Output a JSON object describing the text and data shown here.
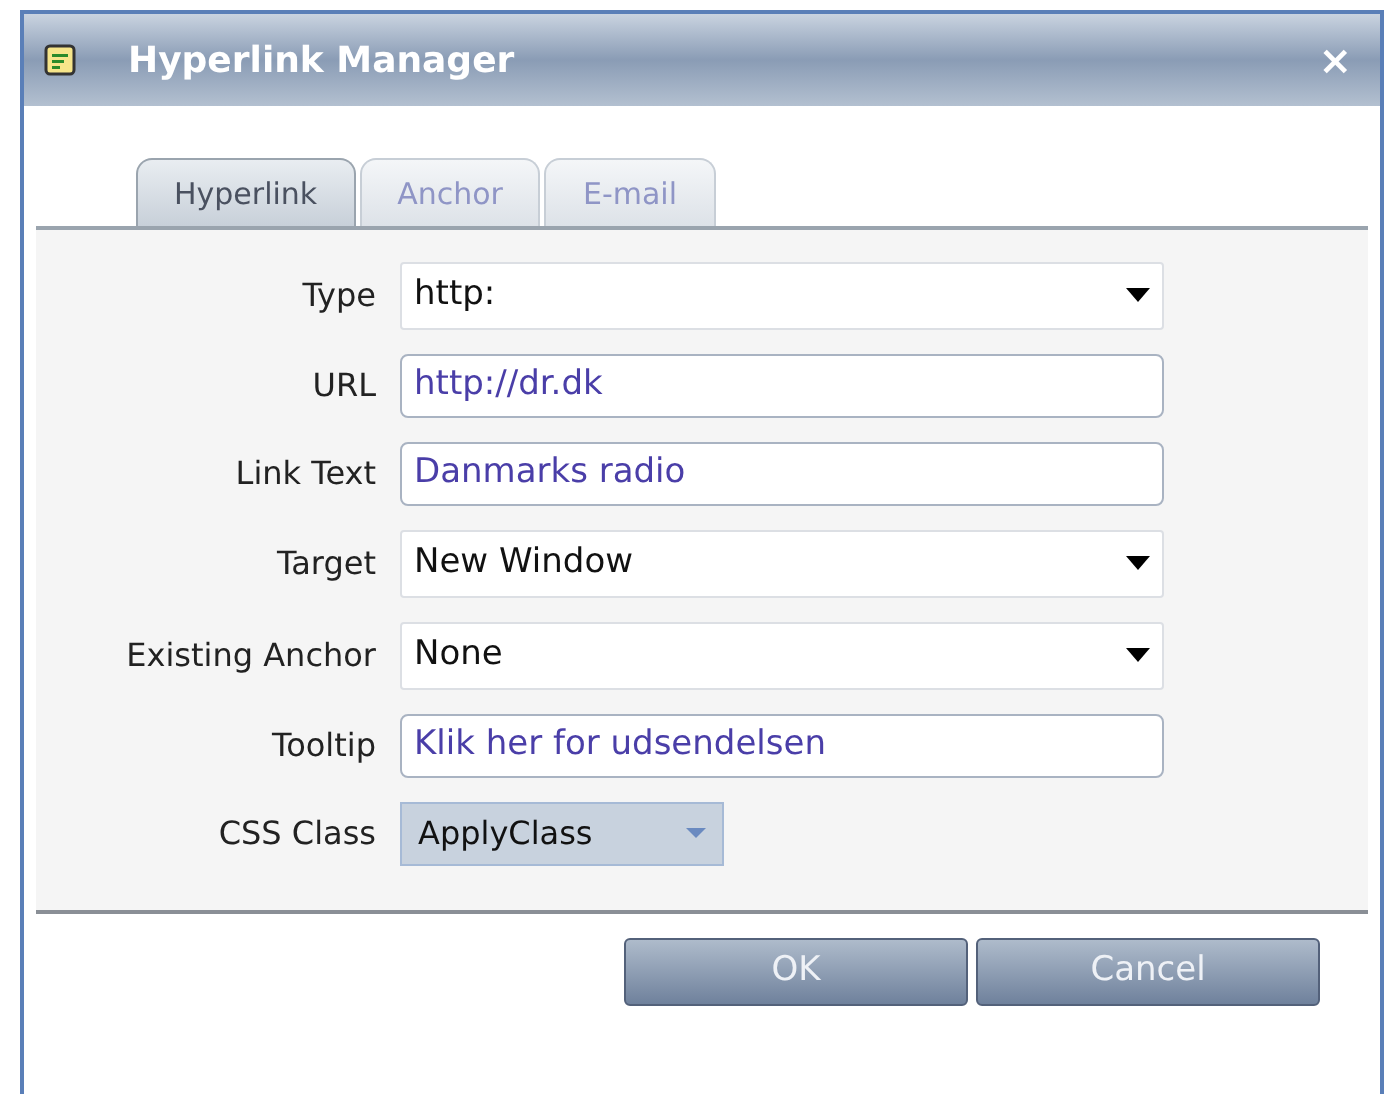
{
  "window": {
    "title": "Hyperlink Manager",
    "close": "×"
  },
  "tabs": [
    {
      "label": "Hyperlink",
      "selected": true
    },
    {
      "label": "Anchor",
      "selected": false
    },
    {
      "label": "E-mail",
      "selected": false
    }
  ],
  "fields": [
    {
      "label": "Type",
      "kind": "select",
      "value": "http:"
    },
    {
      "label": "URL",
      "kind": "text",
      "value": "http://dr.dk"
    },
    {
      "label": "Link Text",
      "kind": "text",
      "value": "Danmarks radio"
    },
    {
      "label": "Target",
      "kind": "select",
      "value": "New Window"
    },
    {
      "label": "Existing Anchor",
      "kind": "select",
      "value": "None"
    },
    {
      "label": "Tooltip",
      "kind": "text",
      "value": "Klik her for udsendelsen"
    },
    {
      "label": "CSS Class",
      "kind": "classpicker",
      "value": "ApplyClass"
    }
  ],
  "buttons": [
    "OK",
    "Cancel"
  ]
}
